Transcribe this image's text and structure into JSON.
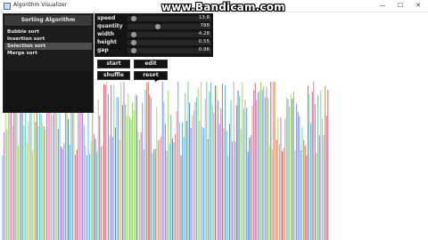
{
  "window": {
    "title": "Algorithm Visualizer",
    "minimize": "—",
    "maximize": "☐",
    "close": "✕"
  },
  "watermark": "www.Bandicam.com",
  "algorithms": {
    "header": "Sorting Algorithm",
    "items": [
      {
        "label": "Bubble sort",
        "selected": false
      },
      {
        "label": "Insertion sort",
        "selected": false
      },
      {
        "label": "Selection sort",
        "selected": true
      },
      {
        "label": "Merge sort",
        "selected": false
      }
    ]
  },
  "params": [
    {
      "label": "speed",
      "value": "13.8",
      "level": 0.05
    },
    {
      "label": "quantity",
      "value": "788",
      "level": 0.35
    },
    {
      "label": "width",
      "value": "4.28",
      "level": 0.04
    },
    {
      "label": "height",
      "value": "0.55",
      "level": 0.04
    },
    {
      "label": "gap",
      "value": "0.96",
      "level": 0.04
    }
  ],
  "buttons": {
    "start": "start",
    "edit": "edit",
    "shuffle": "shuffle",
    "reset": "reset"
  },
  "colors": {
    "panel": "#141414",
    "header": "#3a3a3a",
    "selected": "#4d4d4d",
    "text": "#e6e6e6"
  }
}
